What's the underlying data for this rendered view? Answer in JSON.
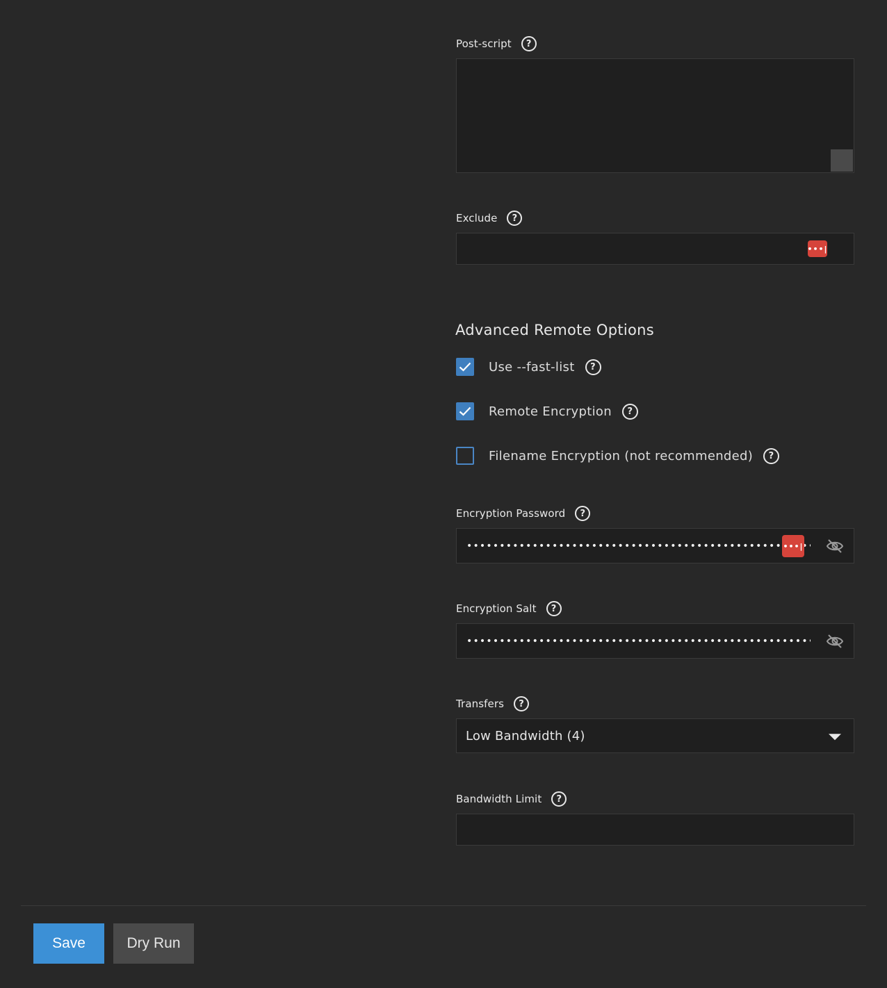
{
  "post_script": {
    "label": "Post-script",
    "value": ""
  },
  "exclude": {
    "label": "Exclude",
    "value": "",
    "pm_badge": "•••|"
  },
  "advanced": {
    "title": "Advanced Remote Options",
    "fast_list": {
      "label": "Use --fast-list",
      "checked": true
    },
    "remote_encryption": {
      "label": "Remote Encryption",
      "checked": true
    },
    "filename_encryption": {
      "label": "Filename Encryption (not recommended)",
      "checked": false
    }
  },
  "encryption_password": {
    "label": "Encryption Password",
    "masked_value": "••••••••••••••••••••••••••••••••••••••••••••••••••••••••••••••••••••••••••",
    "pm_badge": "•••|"
  },
  "encryption_salt": {
    "label": "Encryption Salt",
    "masked_value": "••••••••••••••••••••••••••••••••••••••••••••••••••••••••••••••••••••••••••"
  },
  "transfers": {
    "label": "Transfers",
    "selected": "Low Bandwidth (4)"
  },
  "bandwidth_limit": {
    "label": "Bandwidth Limit",
    "value": ""
  },
  "actions": {
    "save_label": "Save",
    "dry_run_label": "Dry Run"
  },
  "help_glyph": "?",
  "colors": {
    "background": "#282828",
    "input_bg": "#1f1f1f",
    "primary": "#3c90d6",
    "secondary": "#4a4a4a",
    "checkbox": "#3f7fbf",
    "password_manager": "#d6443b"
  }
}
